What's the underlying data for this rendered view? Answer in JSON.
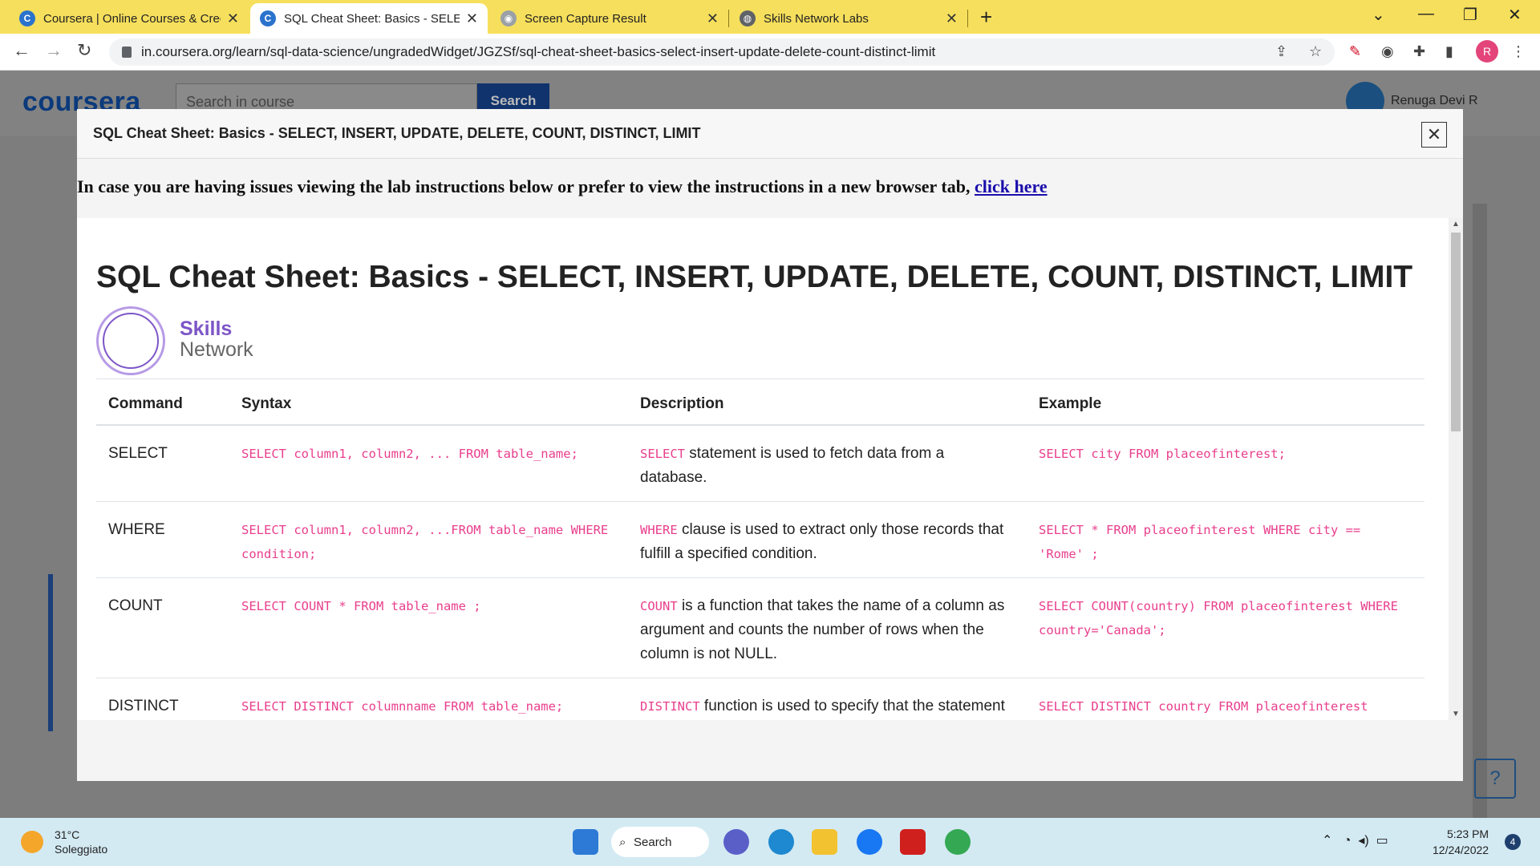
{
  "browser": {
    "tabs": [
      {
        "title": "Coursera | Online Courses & Crec",
        "favicon": "coursera-icon"
      },
      {
        "title": "SQL Cheat Sheet: Basics - SELECT",
        "favicon": "coursera-icon"
      },
      {
        "title": "Screen Capture Result",
        "favicon": "camera-icon"
      },
      {
        "title": "Skills Network Labs",
        "favicon": "globe-icon"
      }
    ],
    "active_tab_index": 1,
    "url": "in.coursera.org/learn/sql-data-science/ungradedWidget/JGZSf/sql-cheat-sheet-basics-select-insert-update-delete-count-distinct-limit",
    "profile_initial": "R"
  },
  "page": {
    "logo": "coursera",
    "search_placeholder": "Search in course",
    "search_button": "Search",
    "user_name": "Renuga Devi R",
    "help_icon": "?"
  },
  "modal": {
    "title": "SQL Cheat Sheet: Basics - SELECT, INSERT, UPDATE, DELETE, COUNT, DISTINCT, LIMIT",
    "notice_text": "In case you are having issues viewing the lab instructions below or prefer to view the instructions in a new browser tab, ",
    "notice_link": "click here",
    "doc": {
      "title": "SQL Cheat Sheet: Basics - SELECT, INSERT, UPDATE, DELETE, COUNT, DISTINCT, LIMIT",
      "brand_line1": "Skills",
      "brand_line2": "Network",
      "headers": [
        "Command",
        "Syntax",
        "Description",
        "Example"
      ],
      "rows": [
        {
          "command": "SELECT",
          "syntax": "SELECT column1, column2, ... FROM table_name;",
          "desc_code": "SELECT",
          "desc_text": " statement is used to fetch data from a database.",
          "example": "SELECT city FROM placeofinterest;"
        },
        {
          "command": "WHERE",
          "syntax": "SELECT column1, column2, ...FROM table_name WHERE condition;",
          "desc_code": "WHERE",
          "desc_text": " clause is used to extract only those records that fulfill a specified condition.",
          "example": "SELECT * FROM placeofinterest WHERE city == 'Rome' ;"
        },
        {
          "command": "COUNT",
          "syntax": "SELECT COUNT * FROM table_name ;",
          "desc_code": "COUNT",
          "desc_text": " is a function that takes the name of a column as argument and counts the number of rows when the column is not NULL.",
          "example": "SELECT COUNT(country) FROM placeofinterest WHERE country='Canada';"
        },
        {
          "command": "DISTINCT",
          "syntax": "SELECT DISTINCT columnname FROM table_name;",
          "desc_code": "DISTINCT",
          "desc_text": " function is used to specify that the statement is a query which returns unique values in",
          "example": "SELECT DISTINCT country FROM placeofinterest WHERE type='historical';"
        }
      ]
    }
  },
  "taskbar": {
    "temperature": "31°C",
    "weather": "Soleggiato",
    "search_label": "Search",
    "time": "5:23 PM",
    "date": "12/24/2022",
    "notification_count": "4"
  }
}
